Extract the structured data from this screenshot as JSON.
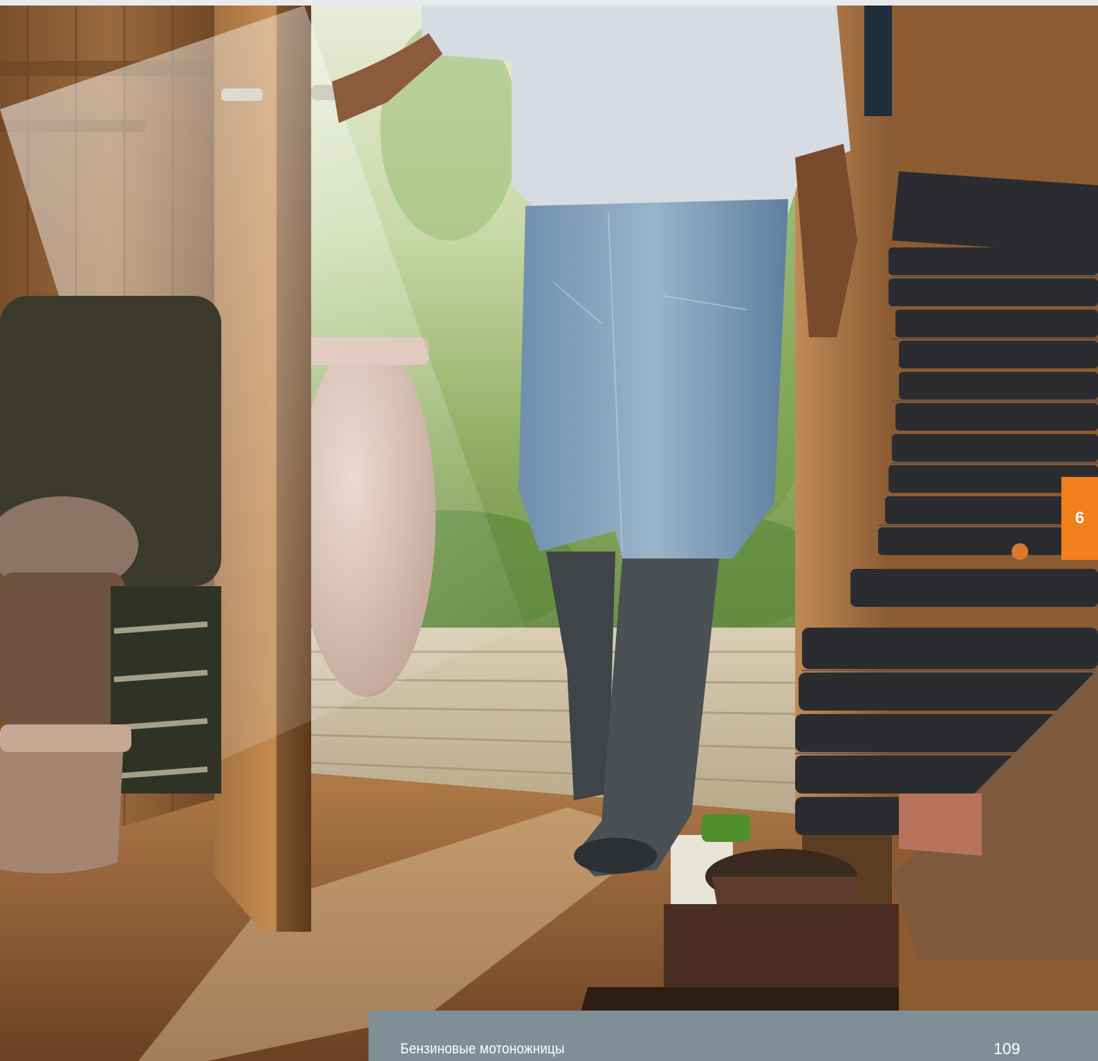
{
  "page": {
    "chapter_number": "6",
    "footer_title": "Бензиновые мотоножницы",
    "page_number": "109"
  },
  "colors": {
    "chapter_tab": "#f07f1c",
    "footer_bar": "#7f8f98",
    "footer_text": "#ffffff"
  }
}
